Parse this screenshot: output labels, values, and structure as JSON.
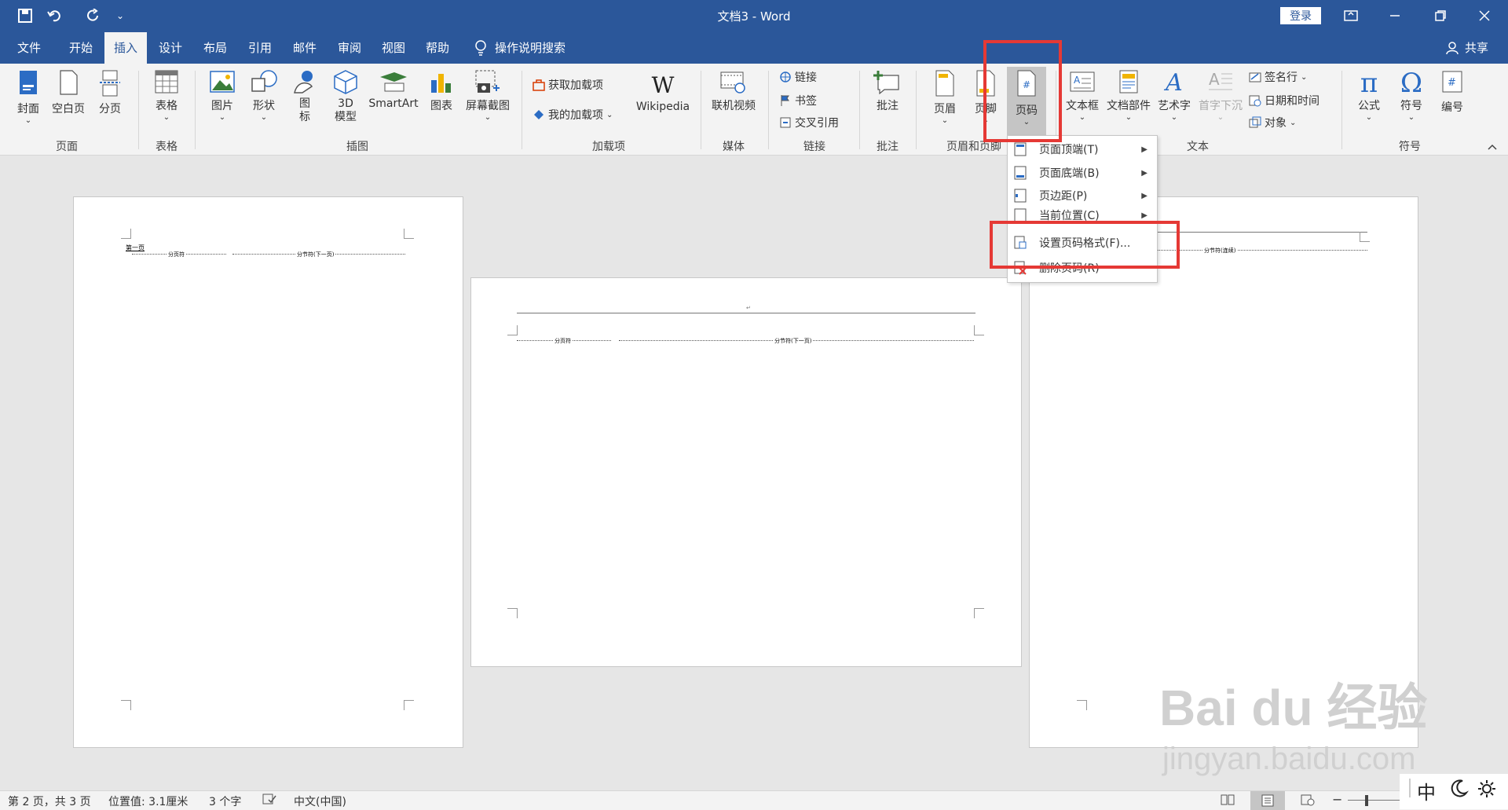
{
  "titlebar": {
    "title": "文档3 - Word",
    "login": "登录",
    "qat_dropdown": "⌄"
  },
  "tabs": [
    "文件",
    "开始",
    "插入",
    "设计",
    "布局",
    "引用",
    "邮件",
    "审阅",
    "视图",
    "帮助"
  ],
  "active_tab": "插入",
  "search_label": "操作说明搜索",
  "share_label": "共享",
  "ribbon": {
    "page": {
      "label": "页面",
      "cover": "封面",
      "blank": "空白页",
      "break": "分页"
    },
    "table": {
      "label": "表格",
      "table": "表格"
    },
    "illus": {
      "label": "插图",
      "pictures": "图片",
      "shapes": "形状",
      "icons": "图\n标",
      "model3d": "3D\n模型",
      "smartart": "SmartArt",
      "chart": "图表",
      "screenshot": "屏幕截图"
    },
    "addins": {
      "label": "加载项",
      "get": "获取加载项",
      "my": "我的加载项",
      "wikipedia": "Wikipedia"
    },
    "media": {
      "label": "媒体",
      "video": "联机视频"
    },
    "links": {
      "label": "链接",
      "link": "链接",
      "bookmark": "书签",
      "crossref": "交叉引用"
    },
    "comments": {
      "label": "批注",
      "comment": "批注"
    },
    "hf": {
      "label": "页眉和页脚",
      "header": "页眉",
      "footer": "页脚",
      "pagenum": "页码"
    },
    "text": {
      "label": "文本",
      "textbox": "文本框",
      "parts": "文档部件",
      "wordart": "艺术字",
      "dropcap": "首字下沉",
      "sigline": "签名行",
      "datetime": "日期和时间",
      "object": "对象"
    },
    "symbols": {
      "label": "符号",
      "equation": "公式",
      "symbol": "符号",
      "number": "编号"
    }
  },
  "menu": {
    "items": [
      {
        "label": "页面顶端(T)",
        "submenu": true
      },
      {
        "label": "页面底端(B)",
        "submenu": true
      },
      {
        "label": "页边距(P)",
        "submenu": true
      },
      {
        "label": "当前位置(C)",
        "submenu": true
      },
      {
        "label": "设置页码格式(F)...",
        "submenu": false
      },
      {
        "label": "删除页码(R)",
        "submenu": false
      }
    ]
  },
  "doc": {
    "page1": {
      "heading": "第一页",
      "sec_break": "分页符",
      "section_break": "分节符(下一页)"
    },
    "page2": {
      "sec_break": "分页符",
      "section_break": "分节符(下一页)"
    },
    "page3": {
      "section_break": "分节符(连续)"
    }
  },
  "status": {
    "page": "第 2 页，共 3 页",
    "position": "位置值: 3.1厘米",
    "words": "3 个字",
    "lang": "中文(中国)",
    "ime": "中"
  },
  "watermark": {
    "brand": "Bai du 经验",
    "url": "jingyan.baidu.com"
  },
  "colors": {
    "accent": "#2b579a",
    "highlight": "#e53935"
  }
}
